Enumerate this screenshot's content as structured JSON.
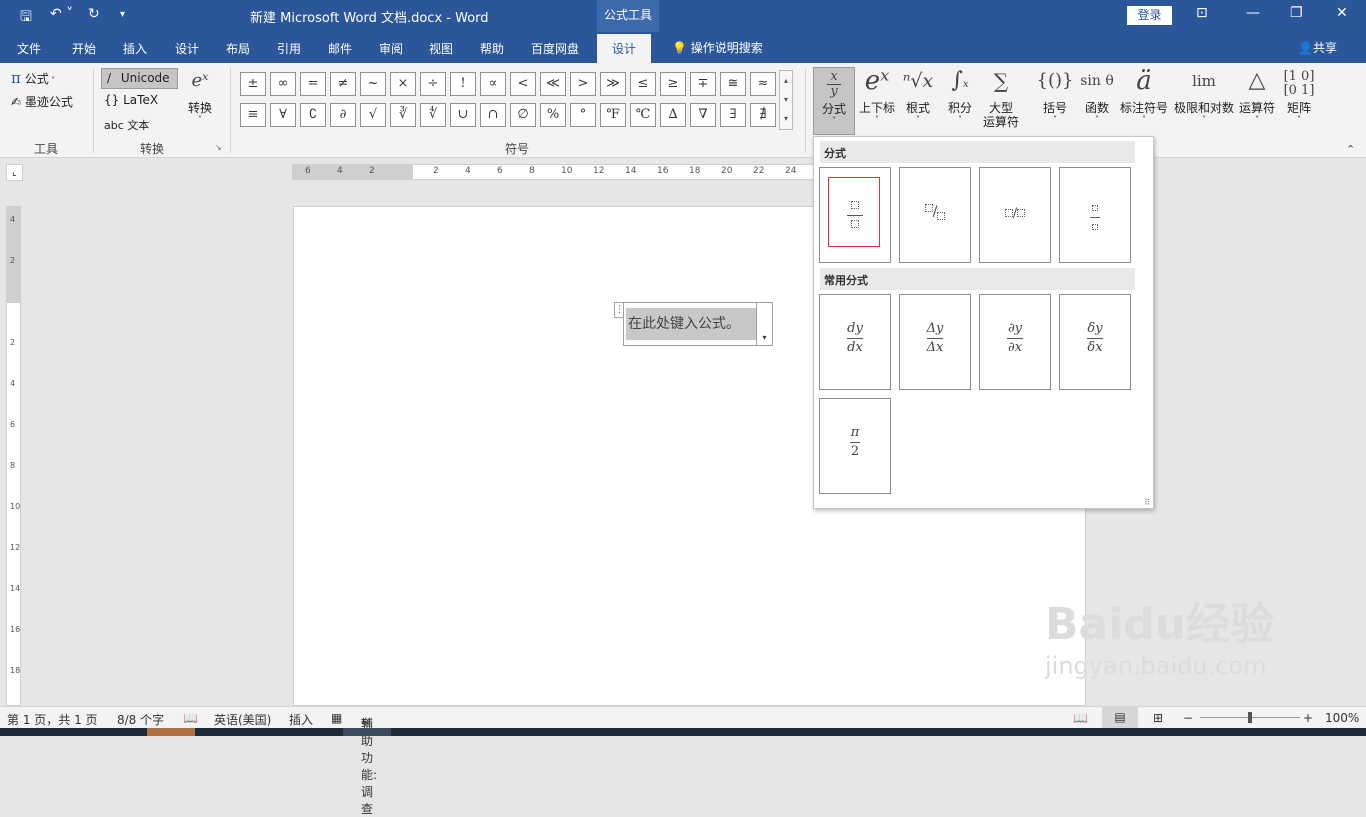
{
  "titlebar": {
    "title": "新建 Microsoft Word 文档.docx  -  Word",
    "context_tab": "公式工具",
    "login": "登录"
  },
  "tabs": [
    {
      "label": "文件"
    },
    {
      "label": "开始"
    },
    {
      "label": "插入"
    },
    {
      "label": "设计"
    },
    {
      "label": "布局"
    },
    {
      "label": "引用"
    },
    {
      "label": "邮件"
    },
    {
      "label": "审阅"
    },
    {
      "label": "视图"
    },
    {
      "label": "帮助"
    },
    {
      "label": "百度网盘"
    },
    {
      "label": "设计"
    }
  ],
  "tell_me": "操作说明搜索",
  "share": "共享",
  "ribbon": {
    "tools": {
      "equation": "公式",
      "ink": "墨迹公式",
      "label": "工具"
    },
    "convert": {
      "unicode": "Unicode",
      "latex": "LaTeX",
      "text": "abc 文本",
      "convert": "转换",
      "label": "转换"
    },
    "symbols_label": "符号",
    "symbols_row1": [
      "±",
      "∞",
      "=",
      "≠",
      "~",
      "×",
      "÷",
      "!",
      "∝",
      "<",
      "≪",
      ">",
      "≫",
      "≤",
      "≥",
      "∓",
      "≅",
      "≈"
    ],
    "symbols_row2": [
      "≡",
      "∀",
      "∁",
      "∂",
      "√",
      "∛",
      "∜",
      "∪",
      "∩",
      "∅",
      "%",
      "°",
      "℉",
      "℃",
      "∆",
      "∇",
      "∃",
      "∄"
    ],
    "structures": [
      {
        "icon": "x/y",
        "label": "分式"
      },
      {
        "icon": "eˣ",
        "label": "上下标"
      },
      {
        "icon": "ⁿ√x",
        "label": "根式"
      },
      {
        "icon": "∫",
        "label": "积分"
      },
      {
        "icon": "∑",
        "label": "大型",
        "label2": "运算符"
      },
      {
        "icon": "{()}",
        "label": "括号"
      },
      {
        "icon": "sin θ",
        "label": "函数"
      },
      {
        "icon": "ä",
        "label": "标注符号"
      },
      {
        "icon": "lim",
        "label": "极限和对数"
      },
      {
        "icon": "△",
        "label": "运算符"
      },
      {
        "icon": "[10 01]",
        "label": "矩阵"
      }
    ]
  },
  "ruler_h_ticks": [
    "6",
    "4",
    "2",
    "",
    "2",
    "4",
    "6",
    "8",
    "10",
    "12",
    "14",
    "16",
    "18",
    "20",
    "22",
    "24"
  ],
  "ruler_v_ticks": [
    "4",
    "2",
    "",
    "2",
    "4",
    "6",
    "8",
    "10",
    "12",
    "14",
    "16",
    "18"
  ],
  "equation_placeholder": "在此处键入公式。",
  "gallery": {
    "section1": "分式",
    "section2": "常用分式",
    "common": [
      {
        "num": "dy",
        "den": "dx"
      },
      {
        "num": "Δy",
        "den": "Δx"
      },
      {
        "num": "∂y",
        "den": "∂x"
      },
      {
        "num": "δy",
        "den": "δx"
      },
      {
        "num": "π",
        "den": "2"
      }
    ]
  },
  "status": {
    "page": "第 1 页，共 1 页",
    "words": "8/8 个字",
    "lang": "英语(美国)",
    "mode": "插入",
    "accessibility": "辅助功能: 调查",
    "zoom": "100%"
  },
  "watermark": "Baidu经验",
  "watermark_url": "jingyan.baidu.com"
}
